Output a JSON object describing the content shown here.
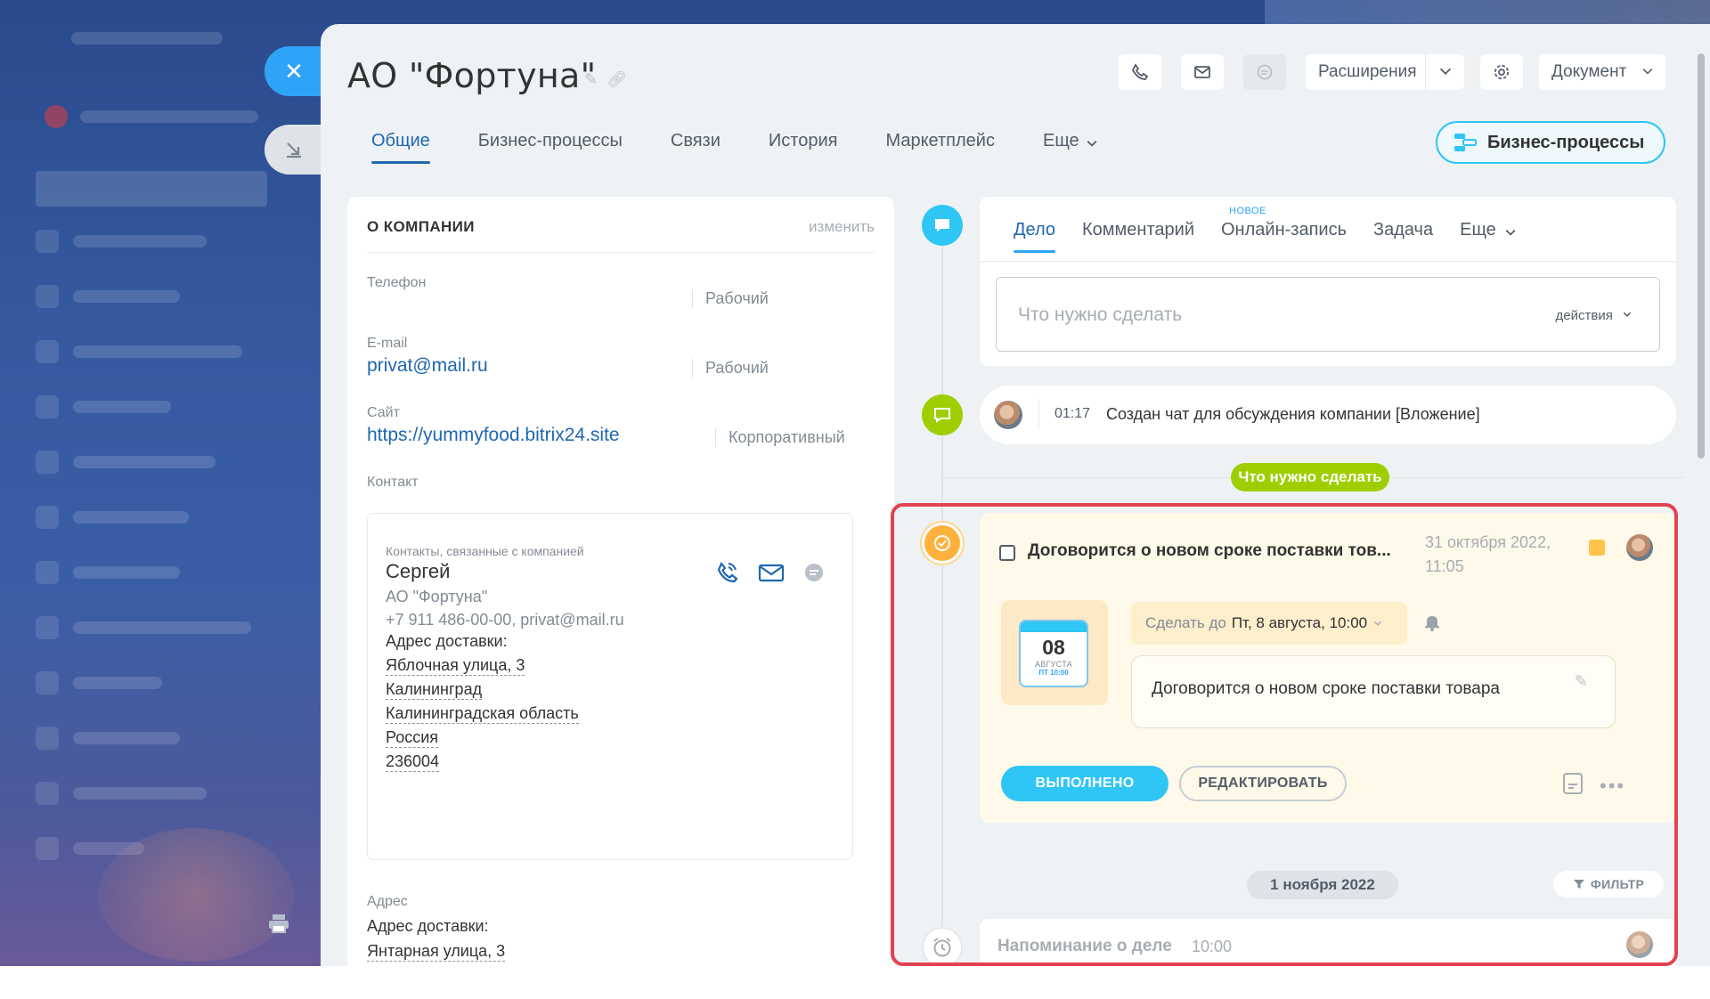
{
  "company": {
    "title": "АО \"Фортуна\""
  },
  "header": {
    "extensions_label": "Расширения",
    "document_label": "Документ",
    "bp_button_label": "Бизнес-процессы"
  },
  "tabs": [
    {
      "label": "Общие",
      "active": true
    },
    {
      "label": "Бизнес-процессы"
    },
    {
      "label": "Связи"
    },
    {
      "label": "История"
    },
    {
      "label": "Маркетплейс"
    },
    {
      "label": "Еще"
    }
  ],
  "about": {
    "section_title": "О КОМПАНИИ",
    "edit_label": "изменить",
    "phone_label": "Телефон",
    "phone_type": "Рабочий",
    "email_label": "E-mail",
    "email_value": "privat@mail.ru",
    "email_type": "Рабочий",
    "site_label": "Сайт",
    "site_value": "https://yummyfood.bitrix24.site",
    "site_type": "Корпоративный",
    "contact_label": "Контакт",
    "contact": {
      "subtitle": "Контакты, связанные с компанией",
      "name": "Сергей",
      "company": "АО \"Фортуна\"",
      "phone_email": "+7 911 486-00-00, privat@mail.ru",
      "delivery_label": "Адрес доставки:",
      "address_lines": [
        "Яблочная улица, 3",
        "Калининград",
        "Калининградская область",
        "Россия",
        "236004"
      ]
    },
    "address_label": "Адрес",
    "address_delivery_label": "Адрес доставки:",
    "address_line": "Янтарная улица, 3"
  },
  "composer": {
    "tabs": [
      "Дело",
      "Комментарий",
      "Онлайн-запись",
      "Задача",
      "Еще"
    ],
    "new_badge": "НОВОЕ",
    "placeholder": "Что нужно сделать",
    "actions_label": "действия"
  },
  "chat_item": {
    "time": "01:17",
    "text": "Создан чат для обсуждения компании [Вложение]"
  },
  "todo_badge": "Что нужно сделать",
  "activity": {
    "title": "Договорится о новом сроке поставки тов...",
    "date_line1": "31 октября 2022,",
    "date_line2": "11:05",
    "cal_day": "08",
    "cal_month": "АВГУСТА",
    "cal_weekday": "ПТ 10:00",
    "due_prefix": "Сделать до",
    "due_value": "Пт, 8 августа, 10:00",
    "description": "Договорится о новом сроке поставки товара",
    "done_label": "ВЫПОЛНЕНО",
    "edit_label": "РЕДАКТИРОВАТЬ"
  },
  "date_separator": "1 ноября 2022",
  "filter_label": "ФИЛЬТР",
  "reminder": {
    "title": "Напоминание о деле",
    "time": "10:00"
  },
  "colors": {
    "accent_blue": "#2fc6f6",
    "link_blue": "#2067b0",
    "green": "#9dcf00",
    "orange": "#ffb13d",
    "highlight_red": "#e2434f"
  }
}
